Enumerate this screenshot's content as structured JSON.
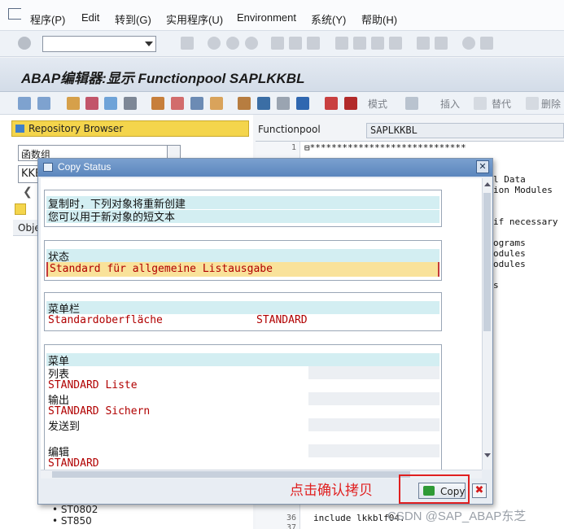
{
  "menu": {
    "items": [
      "程序(P)",
      "Edit",
      "转到(G)",
      "实用程序(U)",
      "Environment",
      "系统(Y)",
      "帮助(H)"
    ]
  },
  "window": {
    "title": "ABAP编辑器:显示 Functionpool SAPLKKBL"
  },
  "app_toolbar": {
    "pattern_label": "模式",
    "insert_label": "插入",
    "replace_label": "替代",
    "delete_label": "删除"
  },
  "left_panel": {
    "repository_browser": "Repository Browser",
    "object_type": "函数组",
    "object_name": "KKBL",
    "obj_header": "Obje",
    "tree_items": [
      "ST0802",
      "ST850"
    ]
  },
  "editor": {
    "functionpool_label": "Functionpool",
    "functionpool_value": "SAPLKKBL",
    "lines": [
      {
        "n": "1",
        "text": "*****************************"
      },
      {
        "n": "",
        "text": "l Data"
      },
      {
        "n": "",
        "text": "ion Modules"
      },
      {
        "n": "",
        "text": "if necessary"
      },
      {
        "n": "",
        "text": "ograms"
      },
      {
        "n": "",
        "text": "odules"
      },
      {
        "n": "",
        "text": "odules"
      },
      {
        "n": "",
        "text": "s"
      },
      {
        "n": "36",
        "text": "include lkkblf04."
      },
      {
        "n": "37",
        "text": ""
      }
    ]
  },
  "dialog": {
    "title": "Copy Status",
    "info_line1": "复制时，下列对象将重新创建",
    "info_line2": "您可以用于新对象的短文本",
    "status_header": "状态",
    "status_value": "Standard für allgemeine Listausgabe",
    "menubar_header": "菜单栏",
    "menubar_name": "Standardoberfläche",
    "menubar_code": "STANDARD",
    "menus_header": "菜单",
    "menus": [
      {
        "label": "列表",
        "value": "STANDARD Liste"
      },
      {
        "label": "输出",
        "value": "STANDARD Sichern"
      },
      {
        "label": "发送到",
        "value": ""
      },
      {
        "label": "编辑",
        "value": "STANDARD"
      }
    ],
    "hint": "点击确认拷贝",
    "copy_label": "Copy"
  },
  "watermark": "CSDN @SAP_ABAP东芝",
  "colors": {
    "highlight_yellow": "#f4d54c",
    "band_cyan": "#d3eef2",
    "value_red": "#b10000",
    "annotation_red": "#e02020",
    "dialog_title_blue": "#5b86bd"
  }
}
